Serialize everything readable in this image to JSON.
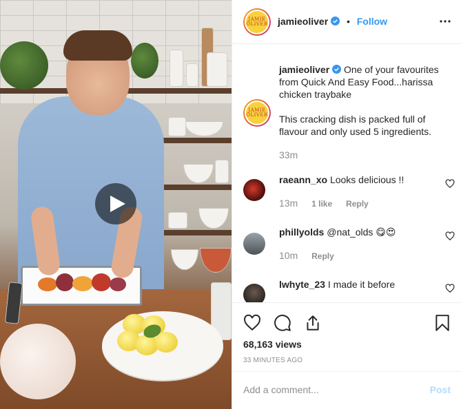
{
  "post": {
    "author": {
      "username": "jamieoliver",
      "verified": true,
      "avatar_label": "JAMIE OLIVER",
      "follow_label": "Follow",
      "separator": "•"
    },
    "caption": {
      "username": "jamieoliver",
      "text_line1": "One of your favourites from Quick And Easy Food...harissa chicken traybake",
      "text_line2": "This cracking dish is packed full of flavour and only used 5 ingredients.",
      "time": "33m"
    },
    "media": {
      "type": "video",
      "play_icon": "play-icon"
    }
  },
  "comments": [
    {
      "username": "raeann_xo",
      "text": "Looks delicious !!",
      "time": "13m",
      "likes": "1 like",
      "reply": "Reply"
    },
    {
      "username": "phillyolds",
      "text": "@nat_olds 😋😍",
      "time": "10m",
      "reply": "Reply"
    },
    {
      "username": "lwhyte_23",
      "text": "I made it before",
      "time": "",
      "reply": ""
    }
  ],
  "stats": {
    "views": "68,163 views",
    "time_ago": "33 MINUTES AGO"
  },
  "add_comment": {
    "placeholder": "Add a comment...",
    "post_label": "Post"
  },
  "icons": {
    "like": "heart-icon",
    "comment": "comment-icon",
    "share": "share-icon",
    "save": "bookmark-icon",
    "more": "more-options-icon"
  },
  "colors": {
    "link_blue": "#3897f0",
    "post_disabled": "#b3dbff",
    "muted": "#8e8e8e",
    "text": "#262626"
  }
}
